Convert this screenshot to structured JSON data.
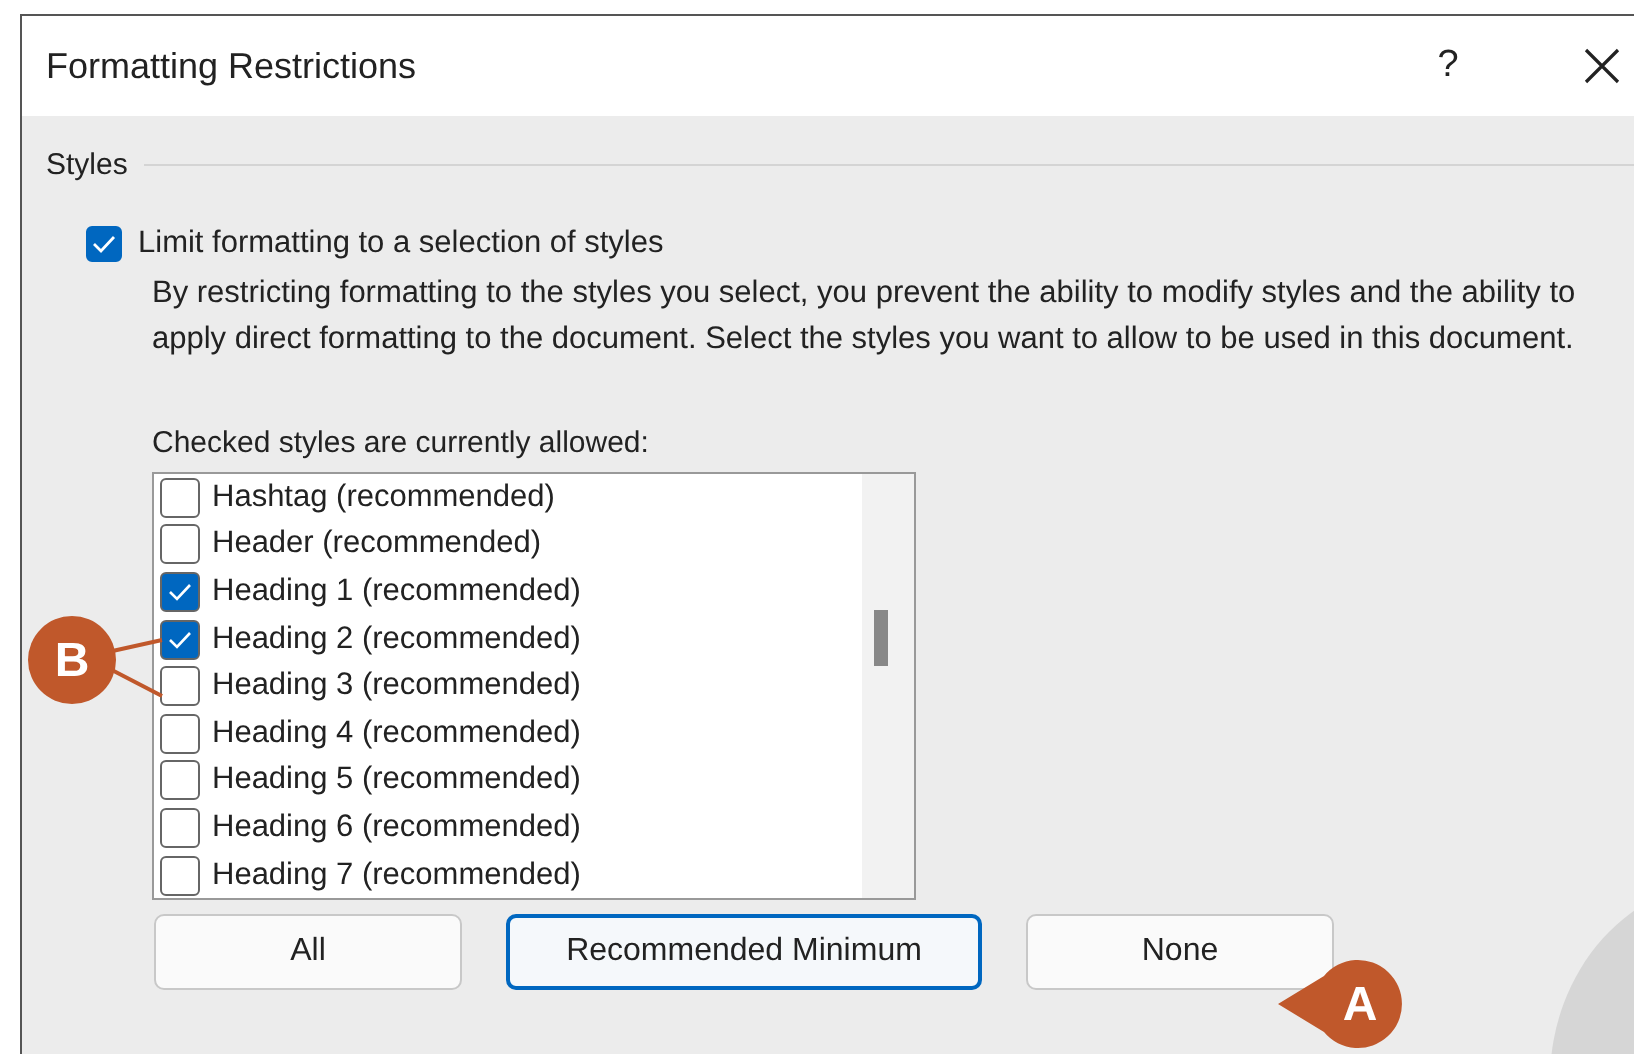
{
  "window": {
    "title": "Formatting Restrictions",
    "help": "?"
  },
  "section": {
    "title": "Styles"
  },
  "limit_option": {
    "label": "Limit formatting to a selection of styles",
    "checked": true
  },
  "description": "By restricting formatting to the styles you select, you prevent the ability to modify styles and the ability to apply direct formatting to the document. Select the styles you want to allow to be used in this document.",
  "list_label": "Checked styles are currently allowed:",
  "styles": [
    {
      "label": "Hashtag (recommended)",
      "checked": false
    },
    {
      "label": "Header (recommended)",
      "checked": false
    },
    {
      "label": "Heading 1 (recommended)",
      "checked": true
    },
    {
      "label": "Heading 2 (recommended)",
      "checked": true
    },
    {
      "label": "Heading 3 (recommended)",
      "checked": false
    },
    {
      "label": "Heading 4 (recommended)",
      "checked": false
    },
    {
      "label": "Heading 5 (recommended)",
      "checked": false
    },
    {
      "label": "Heading 6 (recommended)",
      "checked": false
    },
    {
      "label": "Heading 7 (recommended)",
      "checked": false
    }
  ],
  "buttons": [
    {
      "label": "All",
      "focused": false
    },
    {
      "label": "Recommended Minimum",
      "focused": true
    },
    {
      "label": "None",
      "focused": false
    }
  ],
  "callouts": [
    {
      "label": "A"
    },
    {
      "label": "B"
    }
  ]
}
